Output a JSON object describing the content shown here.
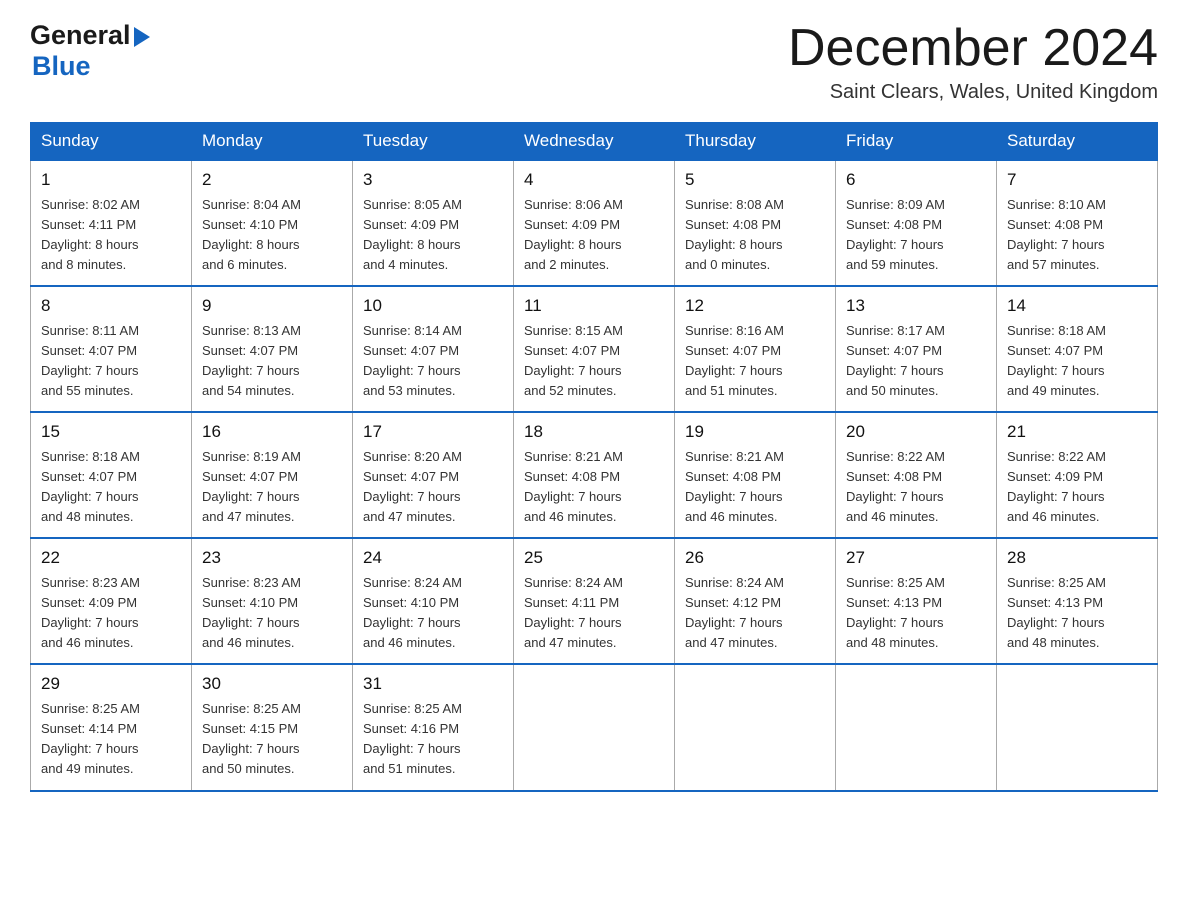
{
  "header": {
    "logo": {
      "text_general": "General",
      "text_blue": "Blue",
      "arrow_unicode": "▶"
    },
    "title": "December 2024",
    "location": "Saint Clears, Wales, United Kingdom"
  },
  "calendar": {
    "days_of_week": [
      "Sunday",
      "Monday",
      "Tuesday",
      "Wednesday",
      "Thursday",
      "Friday",
      "Saturday"
    ],
    "weeks": [
      [
        {
          "day": "1",
          "sunrise": "8:02 AM",
          "sunset": "4:11 PM",
          "daylight": "8 hours and 8 minutes."
        },
        {
          "day": "2",
          "sunrise": "8:04 AM",
          "sunset": "4:10 PM",
          "daylight": "8 hours and 6 minutes."
        },
        {
          "day": "3",
          "sunrise": "8:05 AM",
          "sunset": "4:09 PM",
          "daylight": "8 hours and 4 minutes."
        },
        {
          "day": "4",
          "sunrise": "8:06 AM",
          "sunset": "4:09 PM",
          "daylight": "8 hours and 2 minutes."
        },
        {
          "day": "5",
          "sunrise": "8:08 AM",
          "sunset": "4:08 PM",
          "daylight": "8 hours and 0 minutes."
        },
        {
          "day": "6",
          "sunrise": "8:09 AM",
          "sunset": "4:08 PM",
          "daylight": "7 hours and 59 minutes."
        },
        {
          "day": "7",
          "sunrise": "8:10 AM",
          "sunset": "4:08 PM",
          "daylight": "7 hours and 57 minutes."
        }
      ],
      [
        {
          "day": "8",
          "sunrise": "8:11 AM",
          "sunset": "4:07 PM",
          "daylight": "7 hours and 55 minutes."
        },
        {
          "day": "9",
          "sunrise": "8:13 AM",
          "sunset": "4:07 PM",
          "daylight": "7 hours and 54 minutes."
        },
        {
          "day": "10",
          "sunrise": "8:14 AM",
          "sunset": "4:07 PM",
          "daylight": "7 hours and 53 minutes."
        },
        {
          "day": "11",
          "sunrise": "8:15 AM",
          "sunset": "4:07 PM",
          "daylight": "7 hours and 52 minutes."
        },
        {
          "day": "12",
          "sunrise": "8:16 AM",
          "sunset": "4:07 PM",
          "daylight": "7 hours and 51 minutes."
        },
        {
          "day": "13",
          "sunrise": "8:17 AM",
          "sunset": "4:07 PM",
          "daylight": "7 hours and 50 minutes."
        },
        {
          "day": "14",
          "sunrise": "8:18 AM",
          "sunset": "4:07 PM",
          "daylight": "7 hours and 49 minutes."
        }
      ],
      [
        {
          "day": "15",
          "sunrise": "8:18 AM",
          "sunset": "4:07 PM",
          "daylight": "7 hours and 48 minutes."
        },
        {
          "day": "16",
          "sunrise": "8:19 AM",
          "sunset": "4:07 PM",
          "daylight": "7 hours and 47 minutes."
        },
        {
          "day": "17",
          "sunrise": "8:20 AM",
          "sunset": "4:07 PM",
          "daylight": "7 hours and 47 minutes."
        },
        {
          "day": "18",
          "sunrise": "8:21 AM",
          "sunset": "4:08 PM",
          "daylight": "7 hours and 46 minutes."
        },
        {
          "day": "19",
          "sunrise": "8:21 AM",
          "sunset": "4:08 PM",
          "daylight": "7 hours and 46 minutes."
        },
        {
          "day": "20",
          "sunrise": "8:22 AM",
          "sunset": "4:08 PM",
          "daylight": "7 hours and 46 minutes."
        },
        {
          "day": "21",
          "sunrise": "8:22 AM",
          "sunset": "4:09 PM",
          "daylight": "7 hours and 46 minutes."
        }
      ],
      [
        {
          "day": "22",
          "sunrise": "8:23 AM",
          "sunset": "4:09 PM",
          "daylight": "7 hours and 46 minutes."
        },
        {
          "day": "23",
          "sunrise": "8:23 AM",
          "sunset": "4:10 PM",
          "daylight": "7 hours and 46 minutes."
        },
        {
          "day": "24",
          "sunrise": "8:24 AM",
          "sunset": "4:10 PM",
          "daylight": "7 hours and 46 minutes."
        },
        {
          "day": "25",
          "sunrise": "8:24 AM",
          "sunset": "4:11 PM",
          "daylight": "7 hours and 47 minutes."
        },
        {
          "day": "26",
          "sunrise": "8:24 AM",
          "sunset": "4:12 PM",
          "daylight": "7 hours and 47 minutes."
        },
        {
          "day": "27",
          "sunrise": "8:25 AM",
          "sunset": "4:13 PM",
          "daylight": "7 hours and 48 minutes."
        },
        {
          "day": "28",
          "sunrise": "8:25 AM",
          "sunset": "4:13 PM",
          "daylight": "7 hours and 48 minutes."
        }
      ],
      [
        {
          "day": "29",
          "sunrise": "8:25 AM",
          "sunset": "4:14 PM",
          "daylight": "7 hours and 49 minutes."
        },
        {
          "day": "30",
          "sunrise": "8:25 AM",
          "sunset": "4:15 PM",
          "daylight": "7 hours and 50 minutes."
        },
        {
          "day": "31",
          "sunrise": "8:25 AM",
          "sunset": "4:16 PM",
          "daylight": "7 hours and 51 minutes."
        },
        null,
        null,
        null,
        null
      ]
    ],
    "labels": {
      "sunrise": "Sunrise: ",
      "sunset": "Sunset: ",
      "daylight": "Daylight: "
    }
  }
}
